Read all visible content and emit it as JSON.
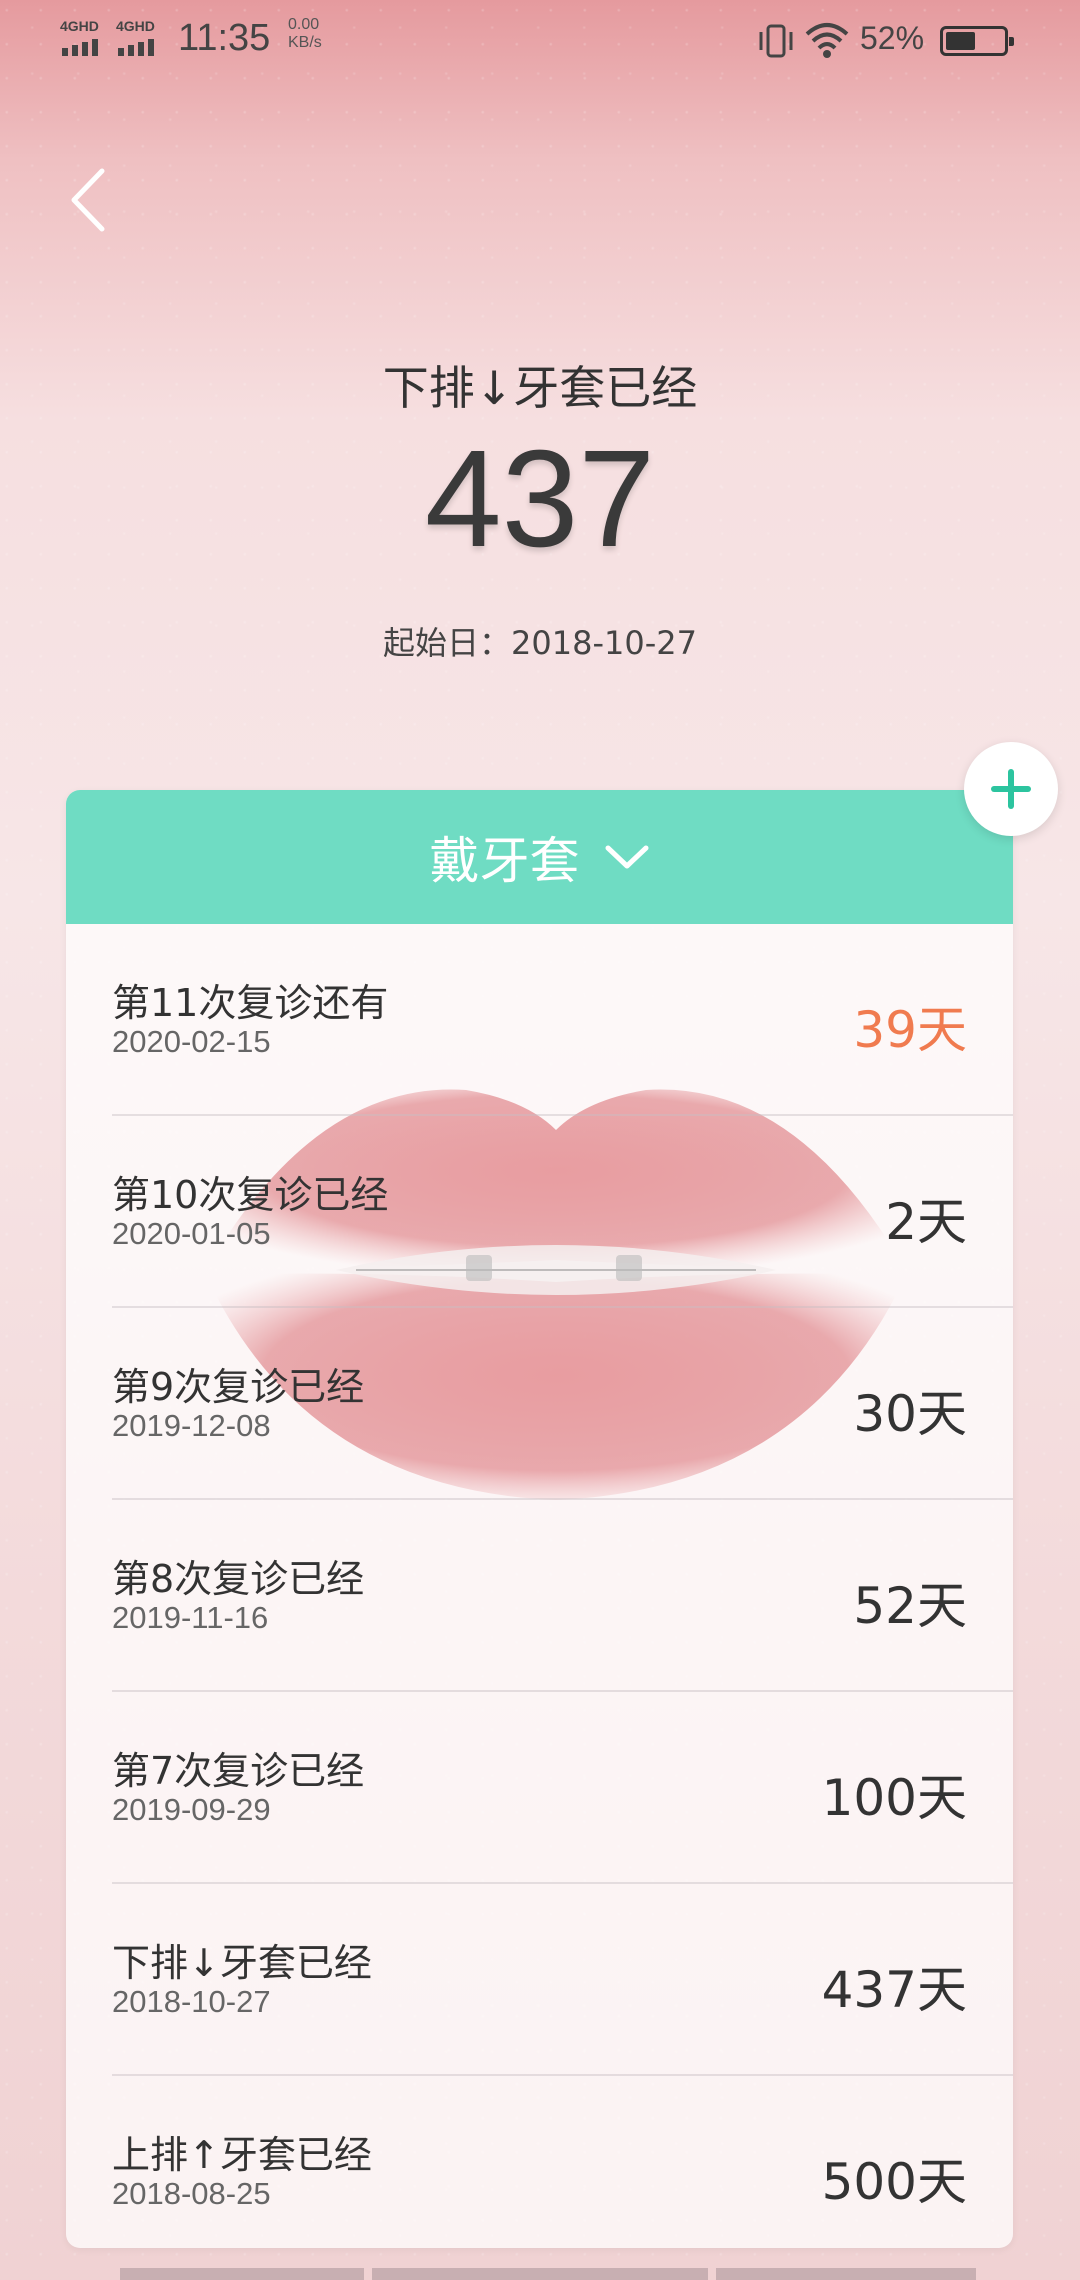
{
  "status_bar": {
    "signal1_label": "4GHD",
    "signal2_label": "4GHD",
    "time": "11:35",
    "net_speed_value": "0.00",
    "net_speed_unit": "KB/s",
    "battery_percent": "52%",
    "battery_level": 0.52
  },
  "header": {
    "back_icon": "chevron-left-icon"
  },
  "hero": {
    "title": "下排↓牙套已经",
    "number": "437",
    "start_date": "起始日：2018-10-27"
  },
  "add_button": {
    "icon": "plus-icon",
    "color": "#2cc49f"
  },
  "card": {
    "header_label": "戴牙套",
    "header_color": "#6fdcc3",
    "header_icon": "chevron-down-icon",
    "rows": [
      {
        "title": "第11次复诊还有",
        "date": "2020-02-15",
        "days": "39天"
      },
      {
        "title": "第10次复诊已经",
        "date": "2020-01-05",
        "days": "2天"
      },
      {
        "title": "第9次复诊已经",
        "date": "2019-12-08",
        "days": "30天"
      },
      {
        "title": "第8次复诊已经",
        "date": "2019-11-16",
        "days": "52天"
      },
      {
        "title": "第7次复诊已经",
        "date": "2019-09-29",
        "days": "100天"
      },
      {
        "title": "下排↓牙套已经",
        "date": "2018-10-27",
        "days": "437天"
      },
      {
        "title": "上排↑牙套已经",
        "date": "2018-08-25",
        "days": "500天"
      }
    ],
    "accent_color": "#f07b4f"
  }
}
